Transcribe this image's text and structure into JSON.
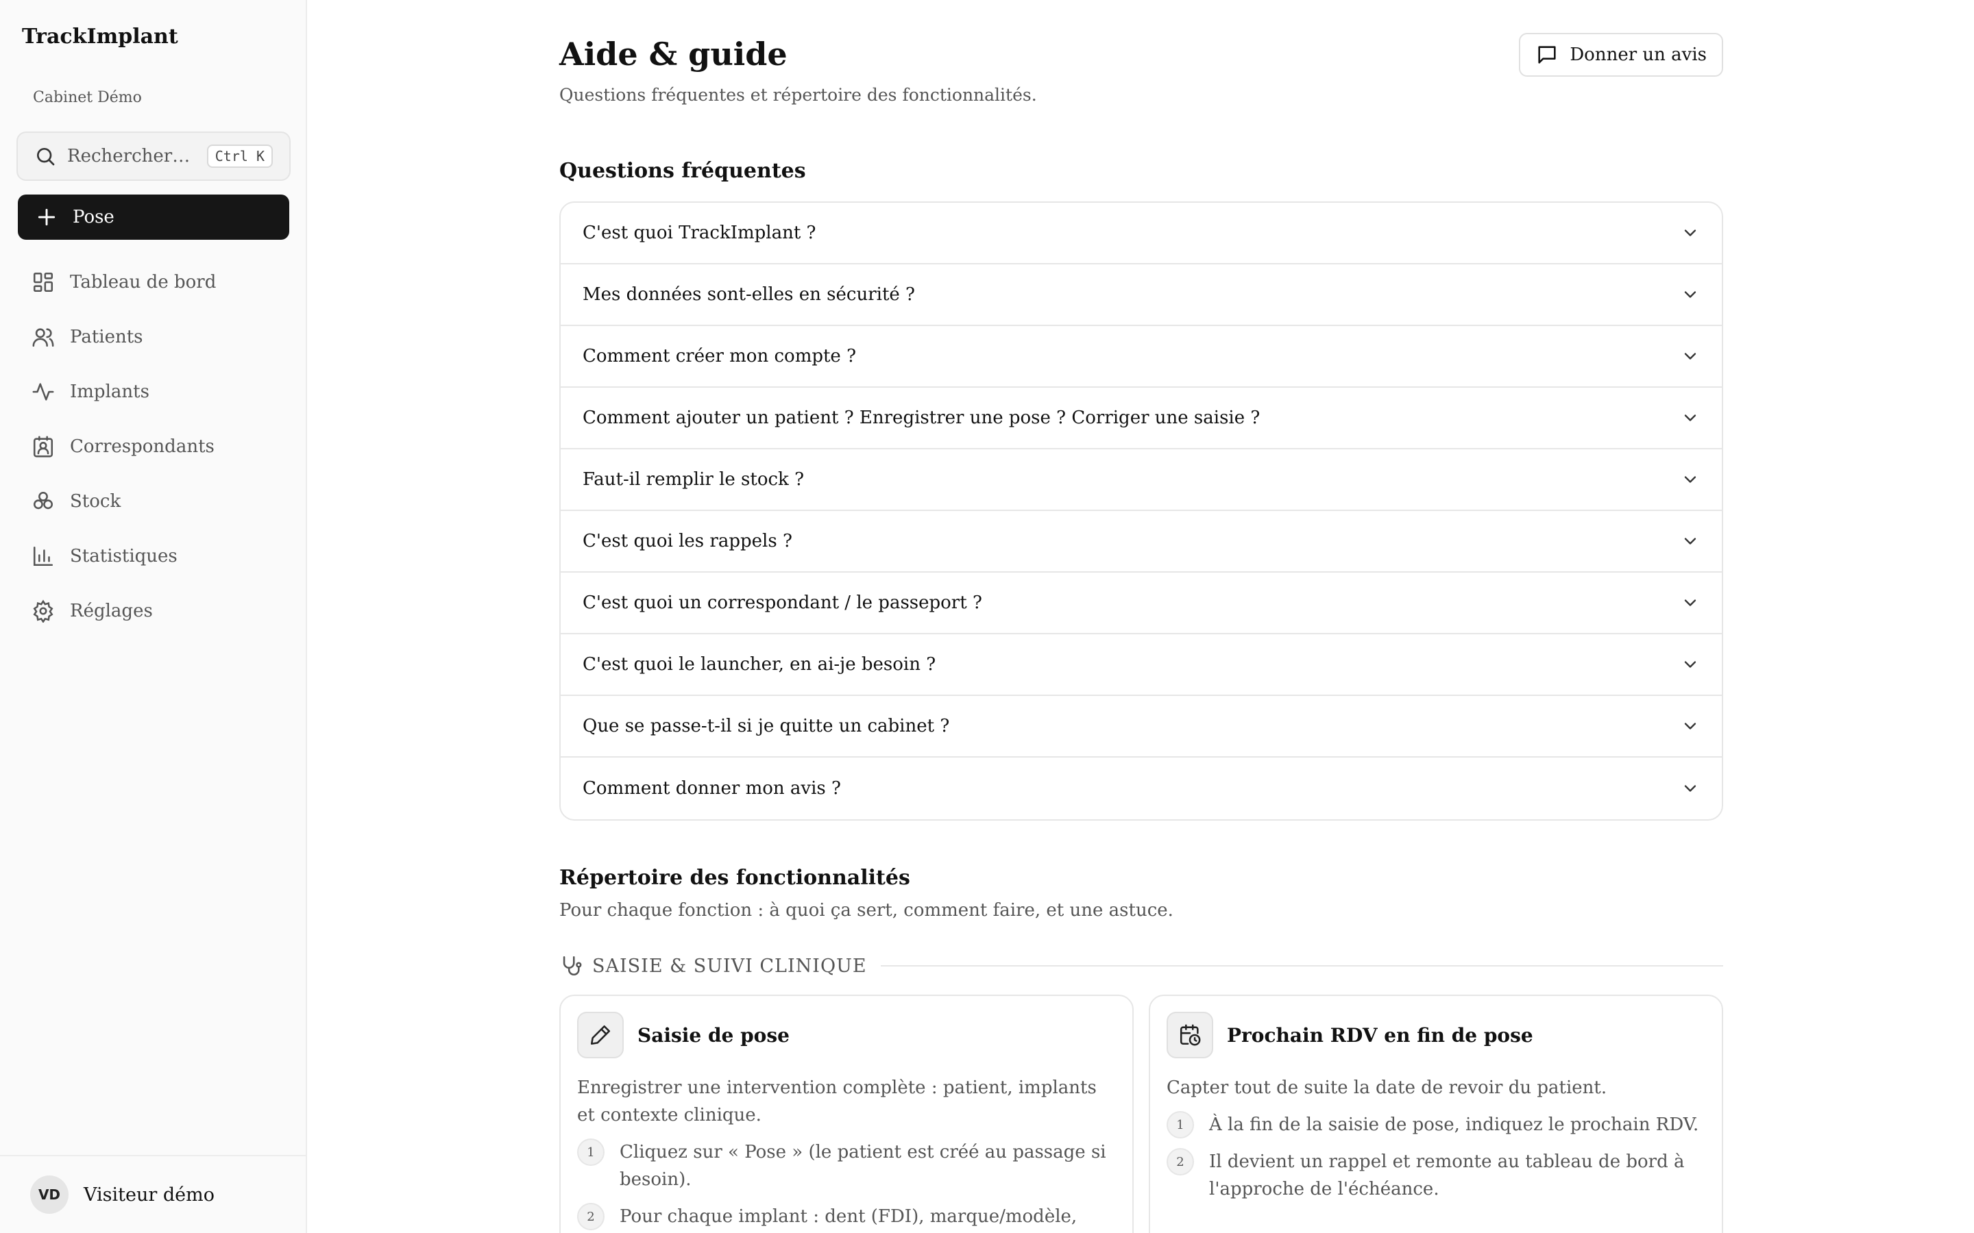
{
  "sidebar": {
    "brand": "TrackImplant",
    "cabinet": "Cabinet Démo",
    "search_placeholder": "Rechercher…",
    "search_shortcut": "Ctrl K",
    "new_button_label": "Pose",
    "items": [
      {
        "label": "Tableau de bord",
        "icon": "dashboard-icon"
      },
      {
        "label": "Patients",
        "icon": "users-icon"
      },
      {
        "label": "Implants",
        "icon": "activity-icon"
      },
      {
        "label": "Correspondants",
        "icon": "contact-icon"
      },
      {
        "label": "Stock",
        "icon": "boxes-icon"
      },
      {
        "label": "Statistiques",
        "icon": "bar-chart-icon"
      },
      {
        "label": "Réglages",
        "icon": "gear-icon"
      }
    ],
    "user": {
      "initials": "VD",
      "name": "Visiteur démo"
    }
  },
  "header": {
    "title": "Aide & guide",
    "subtitle": "Questions fréquentes et répertoire des fonctionnalités.",
    "feedback_label": "Donner un avis"
  },
  "faq": {
    "title": "Questions fréquentes",
    "items": [
      "C'est quoi TrackImplant ?",
      "Mes données sont-elles en sécurité ?",
      "Comment créer mon compte ?",
      "Comment ajouter un patient ? Enregistrer une pose ? Corriger une saisie ?",
      "Faut-il remplir le stock ?",
      "C'est quoi les rappels ?",
      "C'est quoi un correspondant / le passeport ?",
      "C'est quoi le launcher, en ai-je besoin ?",
      "Que se passe-t-il si je quitte un cabinet ?",
      "Comment donner mon avis ?"
    ]
  },
  "directory": {
    "title": "Répertoire des fonctionnalités",
    "subtitle": "Pour chaque fonction : à quoi ça sert, comment faire, et une astuce.",
    "category": "SAISIE & SUIVI CLINIQUE",
    "cards": [
      {
        "title": "Saisie de pose",
        "desc": "Enregistrer une intervention complète : patient, implants et contexte clinique.",
        "steps": [
          {
            "num": "1",
            "text": "Cliquez sur « Pose » (le patient est créé au passage si besoin)."
          },
          {
            "num": "2",
            "text": "Pour chaque implant : dent (FDI), marque/modèle, ⌀/longueur, torque, n° de lot, type de fermeture."
          }
        ]
      },
      {
        "title": "Prochain RDV en fin de pose",
        "desc": "Capter tout de suite la date de revoir du patient.",
        "steps": [
          {
            "num": "1",
            "text": "À la fin de la saisie de pose, indiquez le prochain RDV."
          },
          {
            "num": "2",
            "text": "Il devient un rappel et remonte au tableau de bord à l'approche de l'échéance."
          }
        ]
      }
    ]
  }
}
